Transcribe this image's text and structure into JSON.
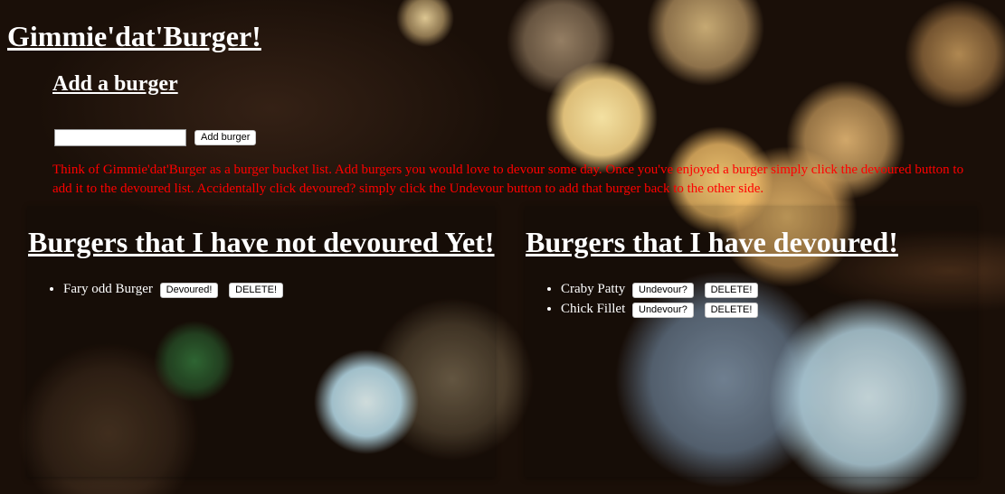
{
  "site": {
    "title": "Gimmie'dat'Burger!"
  },
  "add_section": {
    "title": "Add a burger",
    "input_value": "",
    "add_button_label": "Add burger",
    "instructions": "Think of Gimmie'dat'Burger as a burger bucket list. Add burgers you would love to devour some day. Once you've enjoyed a burger simply click the devoured button to add it to the devoured list. Accidentally click devoured? simply click the Undevour button to add that burger back to the other side."
  },
  "not_devoured": {
    "title": "Burgers that I have not devoured Yet!",
    "items": [
      {
        "name": "Fary odd Burger",
        "action_label": "Devoured!",
        "delete_label": "DELETE!"
      }
    ]
  },
  "devoured": {
    "title": "Burgers that I have devoured!",
    "items": [
      {
        "name": "Craby Patty",
        "action_label": "Undevour?",
        "delete_label": "DELETE!"
      },
      {
        "name": "Chick Fillet",
        "action_label": "Undevour?",
        "delete_label": "DELETE!"
      }
    ]
  },
  "colors": {
    "instructions_text": "#ff0000",
    "heading_text": "#ffffff"
  }
}
